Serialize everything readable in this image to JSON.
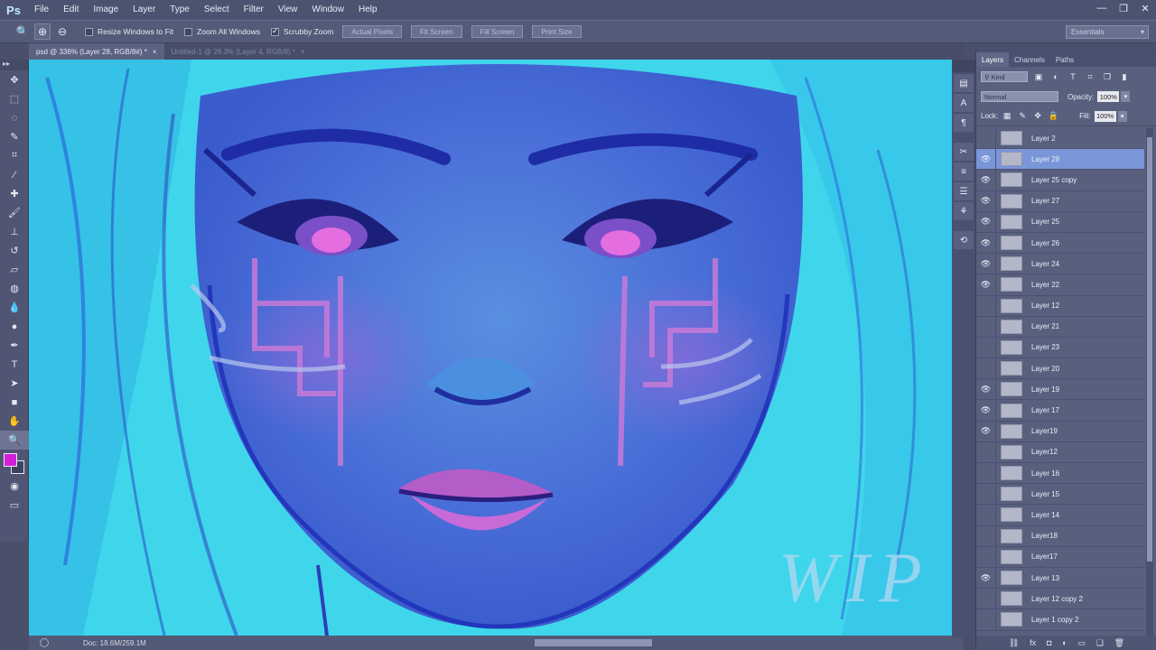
{
  "app": {
    "logo": "Ps"
  },
  "menu": [
    "File",
    "Edit",
    "Image",
    "Layer",
    "Type",
    "Select",
    "Filter",
    "View",
    "Window",
    "Help"
  ],
  "window_controls": {
    "minimize": "—",
    "restore": "❐",
    "close": "✕"
  },
  "options": {
    "resize_windows": "Resize Windows to Fit",
    "zoom_all": "Zoom All Windows",
    "scrubby_zoom": "Scrubby Zoom",
    "actual_pixels": "Actual Pixels",
    "fit_screen": "Fit Screen",
    "fill_screen": "Fill Screen",
    "print_size": "Print Size",
    "workspace": "Essentials"
  },
  "doc_tabs": [
    {
      "label": "psd @ 336% (Layer 28, RGB/8#) *",
      "close": "×"
    },
    {
      "label": "Untitled-1 @ 28.3% (Layer 4, RGB/8) *",
      "close": "×"
    }
  ],
  "status": {
    "doc": "Doc: 18.6M/259.1M"
  },
  "canvas": {
    "watermark": "WIP"
  },
  "panel": {
    "tabs": [
      "Layers",
      "Channels",
      "Paths"
    ],
    "kind": "Kind",
    "blend": "Normal",
    "opacity_label": "Opacity:",
    "opacity": "100%",
    "lock_label": "Lock:",
    "fill_label": "Fill:",
    "fill": "100%"
  },
  "layers": [
    {
      "name": "Layer 2",
      "visible": false
    },
    {
      "name": "Layer 28",
      "visible": true,
      "selected": true
    },
    {
      "name": "Layer 25 copy",
      "visible": true
    },
    {
      "name": "Layer 27",
      "visible": true
    },
    {
      "name": "Layer 25",
      "visible": true
    },
    {
      "name": "Layer 26",
      "visible": true
    },
    {
      "name": "Layer 24",
      "visible": true
    },
    {
      "name": "Layer 22",
      "visible": true
    },
    {
      "name": "Layer 12",
      "visible": false
    },
    {
      "name": "Layer 21",
      "visible": false
    },
    {
      "name": "Layer 23",
      "visible": false
    },
    {
      "name": "Layer 20",
      "visible": false
    },
    {
      "name": "Layer 19",
      "visible": true
    },
    {
      "name": "Layer 17",
      "visible": true
    },
    {
      "name": "Layer19",
      "visible": true
    },
    {
      "name": "Layer12",
      "visible": false
    },
    {
      "name": "Layer 16",
      "visible": false
    },
    {
      "name": "Layer 15",
      "visible": false
    },
    {
      "name": "Layer 14",
      "visible": false
    },
    {
      "name": "Layer18",
      "visible": false
    },
    {
      "name": "Layer17",
      "visible": false
    },
    {
      "name": "Layer 13",
      "visible": true
    },
    {
      "name": "Layer 12 copy 2",
      "visible": false
    },
    {
      "name": "Layer 1 copy 2",
      "visible": false
    }
  ],
  "colors": {
    "foreground": "#d21fd8",
    "selected_layer": "#7a96d9"
  }
}
